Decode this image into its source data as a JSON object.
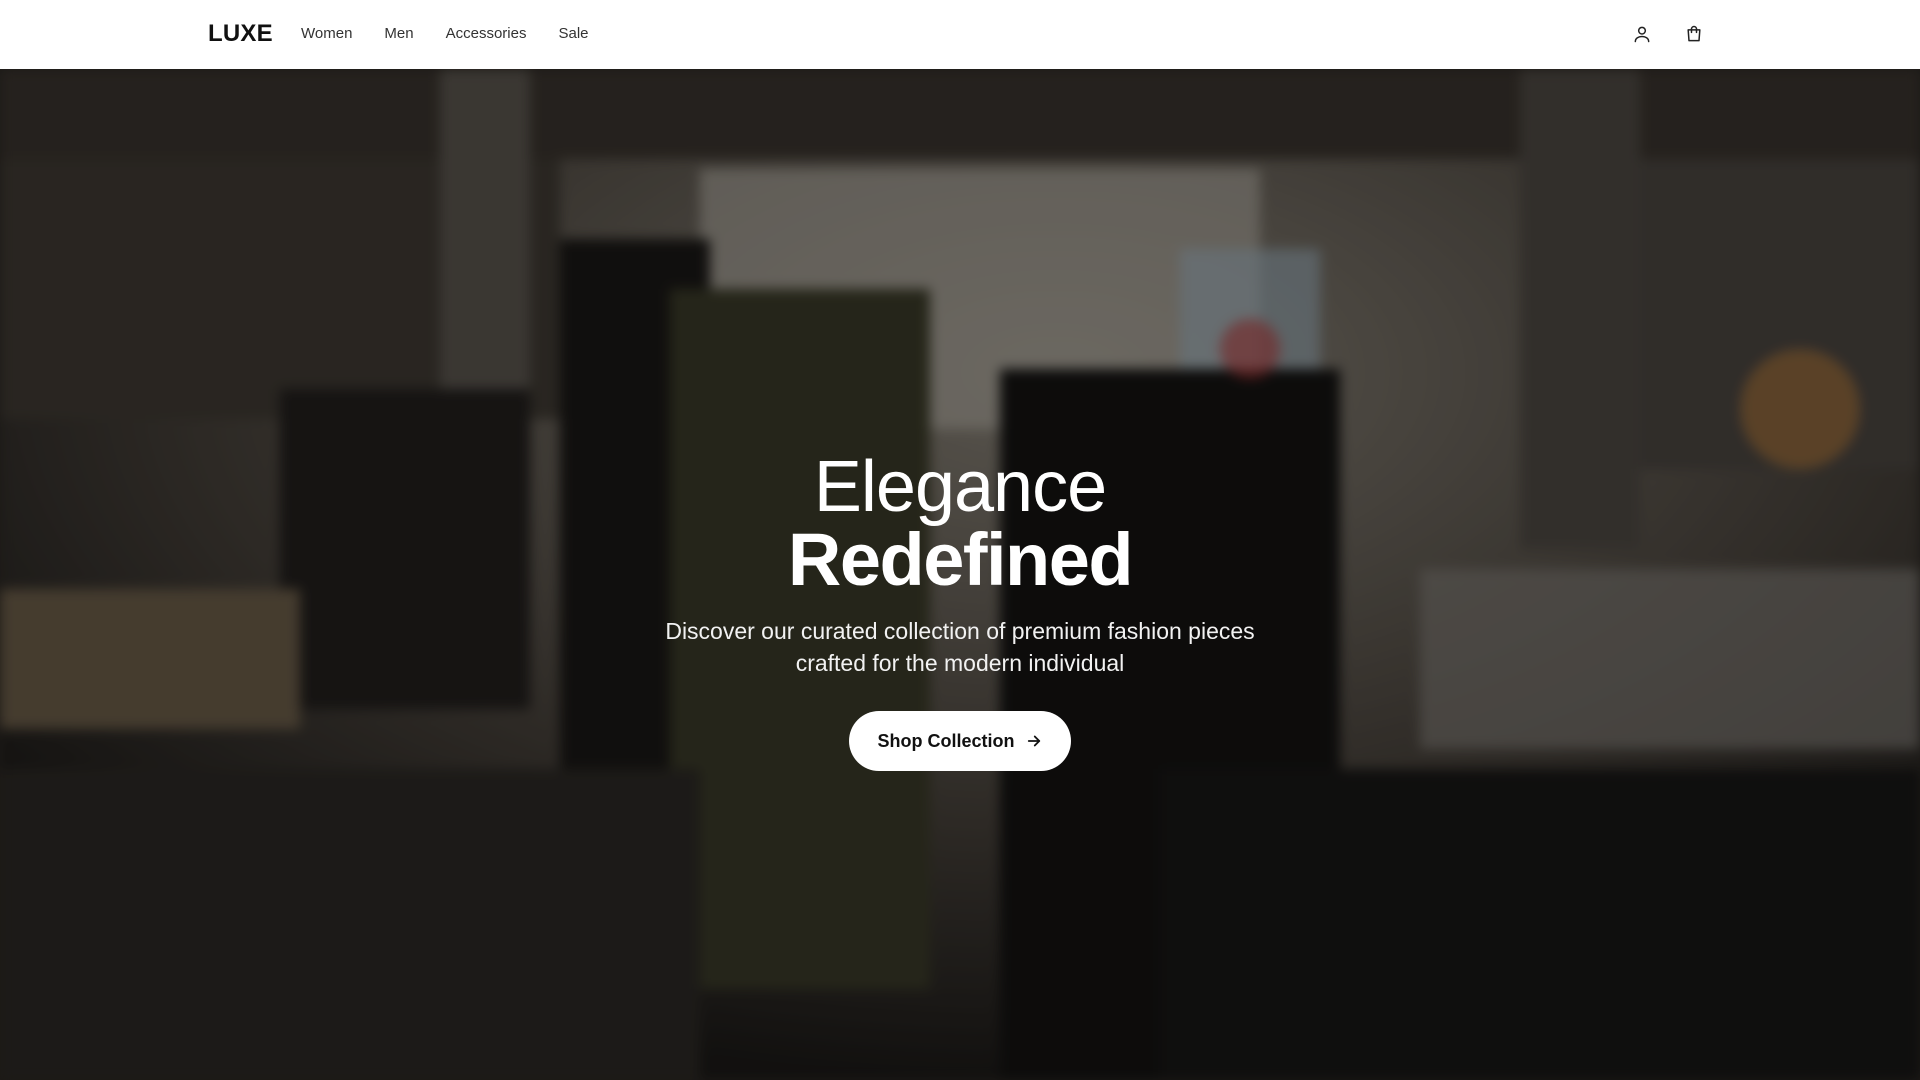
{
  "brand": {
    "logo": "LUXE"
  },
  "nav": {
    "links": [
      {
        "label": "Women"
      },
      {
        "label": "Men"
      },
      {
        "label": "Accessories"
      },
      {
        "label": "Sale"
      }
    ],
    "icons": [
      "user-icon",
      "shopping-bag-icon"
    ]
  },
  "hero": {
    "title_light": "Elegance",
    "title_bold": "Redefined",
    "subtitle": "Discover our curated collection of premium fashion pieces crafted for the modern individual",
    "cta_label": "Shop Collection",
    "cta_icon": "arrow-right-icon",
    "background": "blurred-store-interior-image"
  },
  "colors": {
    "nav_bg": "#ffffff",
    "text_dark": "#111111",
    "hero_text": "#ffffff",
    "cta_bg": "#ffffff"
  }
}
